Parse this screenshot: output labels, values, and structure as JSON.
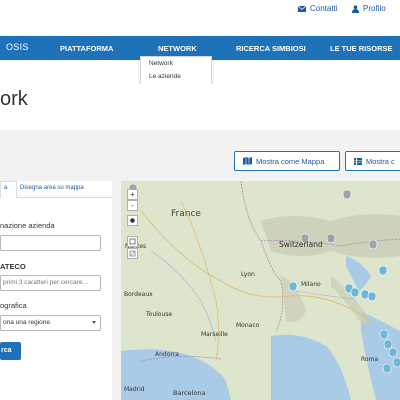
{
  "topbar": {
    "contacts": "Contatti",
    "profile": "Profilo",
    "accent": "#1e72b8"
  },
  "nav": {
    "brand": "OSIS",
    "items": [
      {
        "label": "PIATTAFORMA"
      },
      {
        "label": "NETWORK"
      },
      {
        "label": "RICERCA SIMBIOSI"
      },
      {
        "label": "LE TUE RISORSE"
      }
    ],
    "dropdown": [
      "Network",
      "Le aziende"
    ]
  },
  "page": {
    "title": "ork"
  },
  "views": {
    "map_label": "Mostra come Mappa",
    "list_label": "Mostra c"
  },
  "filters": {
    "tabs": [
      "a",
      "Disegna area su mappa"
    ],
    "name_label": "nazione azienda",
    "name_value": "",
    "ateco_label": "ATECO",
    "ateco_placeholder": "primi 3 caratteri per cercare...",
    "geo_label": "ografica",
    "region_select": "ona una regione",
    "search_label": "rca"
  },
  "map": {
    "zoom_in": "+",
    "zoom_out": "-",
    "labels": {
      "france": "France",
      "switzerland": "Switzerland",
      "milano": "Milano",
      "lyon": "Lyon",
      "marseille": "Marseille",
      "barcelona": "Barcelona",
      "andorra": "Andorra",
      "monaco": "Monaco",
      "toulouse": "Toulouse",
      "bordeaux": "Bordeaux",
      "nantes": "Nantes",
      "madrid": "Madrid",
      "roma": "Roma"
    }
  }
}
